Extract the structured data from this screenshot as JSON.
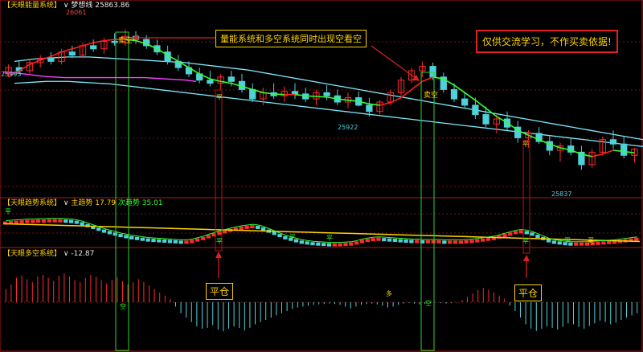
{
  "panels": {
    "energy": {
      "title": "【天眼能量系统】",
      "dropdown": "∨",
      "line_name": "梦想线",
      "value": "25863.86"
    },
    "trend": {
      "title": "【天眼趋势系统】",
      "dropdown": "∨",
      "main_label": "主趋势",
      "main_value": "17.79",
      "sub_label": "次趋势",
      "sub_value": "35.01"
    },
    "longshort": {
      "title": "【天眼多空系统】",
      "dropdown": "∨",
      "value": "-12.87"
    }
  },
  "annotations": {
    "callout": "量能系统和多空系统同时出现空看空",
    "notice": "仅供交流学习，不作买卖依据!",
    "close_position": "平仓",
    "close_position_2": "平仓"
  },
  "price_labels": {
    "high": "26061",
    "left": "25993",
    "mid_low": "25922",
    "low": "25837"
  },
  "markers": {
    "sell": "卖空",
    "sell2": "卖空",
    "flat": "平",
    "buy": "买",
    "empty": "空",
    "many": "多"
  },
  "colors": {
    "background": "#000000",
    "up": "#ff2b2b",
    "down": "#4fd1d9",
    "ma_fast": "#30ff30",
    "ma_red": "#ff2020",
    "band_cyan": "#7fe9ff",
    "band_magenta": "#ff40ff",
    "trend_main": "#ffd400",
    "highlight_box": "#30d030",
    "frame_red": "#b01818",
    "annotation": "#ffd400"
  },
  "chart_data": [
    {
      "type": "candlestick",
      "title": "梦想线 25863.86",
      "ylim": [
        25800,
        26090
      ],
      "candles": [
        [
          25990,
          26005,
          25985,
          26000
        ],
        [
          26000,
          26010,
          25990,
          25995
        ],
        [
          25995,
          26012,
          25990,
          26008
        ],
        [
          26008,
          26020,
          26000,
          26015
        ],
        [
          26015,
          26025,
          26005,
          26010
        ],
        [
          26010,
          26030,
          26005,
          26025
        ],
        [
          26025,
          26035,
          26015,
          26020
        ],
        [
          26020,
          26040,
          26015,
          26035
        ],
        [
          26035,
          26045,
          26025,
          26030
        ],
        [
          26030,
          26048,
          26022,
          26042
        ],
        [
          26042,
          26055,
          26035,
          26040
        ],
        [
          26040,
          26061,
          26035,
          26050
        ],
        [
          26050,
          26058,
          26038,
          26045
        ],
        [
          26045,
          26052,
          26030,
          26035
        ],
        [
          26035,
          26045,
          26020,
          26025
        ],
        [
          26025,
          26035,
          26005,
          26010
        ],
        [
          26010,
          26020,
          25995,
          26000
        ],
        [
          26000,
          26010,
          25985,
          25990
        ],
        [
          25990,
          26000,
          25975,
          25980
        ],
        [
          25980,
          25995,
          25970,
          25975
        ],
        [
          25975,
          25990,
          25965,
          25985
        ],
        [
          25985,
          25995,
          25970,
          25978
        ],
        [
          25978,
          25990,
          25960,
          25965
        ],
        [
          25965,
          25975,
          25945,
          25950
        ],
        [
          25950,
          25968,
          25940,
          25960
        ],
        [
          25960,
          25975,
          25950,
          25955
        ],
        [
          25955,
          25970,
          25945,
          25962
        ],
        [
          25962,
          25975,
          25950,
          25958
        ],
        [
          25958,
          25968,
          25945,
          25950
        ],
        [
          25950,
          25965,
          25940,
          25960
        ],
        [
          25960,
          25972,
          25948,
          25955
        ],
        [
          25955,
          25965,
          25940,
          25945
        ],
        [
          25945,
          25960,
          25935,
          25952
        ],
        [
          25952,
          25962,
          25938,
          25940
        ],
        [
          25940,
          25952,
          25922,
          25930
        ],
        [
          25930,
          25948,
          25925,
          25945
        ],
        [
          25945,
          25965,
          25940,
          25960
        ],
        [
          25960,
          25985,
          25955,
          25980
        ],
        [
          25980,
          26000,
          25975,
          25995
        ],
        [
          25995,
          26010,
          25985,
          26002
        ],
        [
          26002,
          26008,
          25980,
          25985
        ],
        [
          25985,
          25992,
          25960,
          25965
        ],
        [
          25965,
          25975,
          25945,
          25950
        ],
        [
          25950,
          25962,
          25935,
          25940
        ],
        [
          25940,
          25952,
          25918,
          25925
        ],
        [
          25925,
          25938,
          25905,
          25910
        ],
        [
          25910,
          25925,
          25895,
          25918
        ],
        [
          25918,
          25930,
          25900,
          25905
        ],
        [
          25905,
          25915,
          25880,
          25888
        ],
        [
          25888,
          25900,
          25872,
          25895
        ],
        [
          25895,
          25905,
          25878,
          25882
        ],
        [
          25882,
          25892,
          25860,
          25868
        ],
        [
          25868,
          25880,
          25850,
          25875
        ],
        [
          25875,
          25888,
          25860,
          25865
        ],
        [
          25865,
          25875,
          25837,
          25845
        ],
        [
          25845,
          25870,
          25840,
          25865
        ],
        [
          25865,
          25890,
          25860,
          25885
        ],
        [
          25885,
          25900,
          25870,
          25878
        ],
        [
          25878,
          25890,
          25855,
          25860
        ],
        [
          25860,
          25872,
          25848,
          25870
        ]
      ],
      "series": [
        {
          "name": "fast_ma",
          "values": [
            25985,
            25995,
            26005,
            26012,
            26018,
            26025,
            26030,
            26035,
            26040,
            26043,
            26045,
            26045,
            26043,
            26038,
            26030,
            26020,
            26010,
            26000,
            25990,
            25982,
            25978,
            25975,
            25970,
            25965,
            25960,
            25958,
            25957,
            25957,
            25955,
            25954,
            25953,
            25950,
            25948,
            25946,
            25942,
            25940,
            25944,
            25952,
            25965,
            25978,
            25985,
            25982,
            25972,
            25960,
            25948,
            25935,
            25922,
            25912,
            25900,
            25892,
            25885,
            25878,
            25872,
            25868,
            25862,
            25858,
            25862,
            25868,
            25866,
            25864
          ]
        },
        {
          "name": "band_upper",
          "values": [
            26010,
            26012,
            26014,
            26015,
            26016,
            26017,
            26017,
            26017,
            26016,
            26015,
            26014,
            26013,
            26012,
            26011,
            26010,
            26009,
            26008,
            26006,
            26004,
            26002,
            26000,
            25998,
            25996,
            25993,
            25990,
            25987,
            25984,
            25981,
            25978,
            25975,
            25972,
            25969,
            25966,
            25963,
            25960,
            25957,
            25954,
            25951,
            25948,
            25945,
            25942,
            25939,
            25936,
            25933,
            25930,
            25927,
            25924,
            25921,
            25918,
            25915,
            25912,
            25909,
            25906,
            25903,
            25900,
            25897,
            25894,
            25891,
            25888,
            25885
          ]
        },
        {
          "name": "band_lower",
          "values": [
            25975,
            25976,
            25977,
            25978,
            25978,
            25978,
            25977,
            25976,
            25975,
            25974,
            25972,
            25970,
            25968,
            25966,
            25964,
            25962,
            25960,
            25958,
            25956,
            25954,
            25952,
            25950,
            25948,
            25946,
            25944,
            25942,
            25940,
            25938,
            25936,
            25934,
            25932,
            25930,
            25928,
            25926,
            25924,
            25922,
            25920,
            25918,
            25916,
            25914,
            25912,
            25910,
            25908,
            25906,
            25904,
            25902,
            25900,
            25898,
            25896,
            25894,
            25892,
            25890,
            25888,
            25886,
            25884,
            25882,
            25880,
            25878,
            25876,
            25874
          ]
        },
        {
          "name": "magenta_band",
          "values": [
            25993,
            25992,
            25990,
            25988,
            25986,
            25985,
            25984,
            25984,
            25984,
            25984,
            25984,
            25984,
            25984,
            25984,
            25984,
            25983,
            25982,
            25981,
            25980,
            25978
          ]
        }
      ]
    },
    {
      "type": "bar",
      "title": "主趋势 17.79 次趋势 35.01",
      "ylim": [
        0,
        100
      ],
      "values": [
        62,
        63,
        64,
        65,
        66,
        66,
        67,
        67,
        68,
        68,
        68,
        67,
        66,
        64,
        60,
        55,
        50,
        45,
        40,
        36,
        32,
        28,
        25,
        22,
        20,
        18,
        16,
        15,
        14,
        13,
        12,
        11,
        10,
        10,
        12,
        16,
        20,
        25,
        30,
        34,
        38,
        42,
        45,
        48,
        50,
        52,
        50,
        46,
        40,
        34,
        28,
        22,
        18,
        14,
        10,
        8,
        6,
        5,
        4,
        3,
        3,
        3,
        4,
        5,
        8,
        12,
        15,
        17,
        18,
        17,
        16,
        15,
        14,
        13,
        12,
        12,
        11,
        11,
        11,
        11,
        10,
        10,
        10,
        10,
        11,
        12,
        14,
        16,
        18,
        20,
        24,
        28,
        32,
        36,
        38,
        36,
        32,
        26,
        20,
        14,
        10,
        8,
        6,
        5,
        5,
        5,
        5,
        6,
        7,
        8,
        9,
        10,
        12,
        14,
        16,
        18
      ]
    },
    {
      "type": "bar",
      "title": "-12.87",
      "ylim": [
        -100,
        100
      ],
      "values": [
        30,
        40,
        55,
        60,
        52,
        45,
        58,
        62,
        55,
        48,
        60,
        65,
        58,
        50,
        45,
        55,
        62,
        58,
        50,
        42,
        50,
        56,
        48,
        40,
        45,
        52,
        46,
        38,
        30,
        22,
        15,
        8,
        -10,
        -25,
        -35,
        -45,
        -55,
        -60,
        -58,
        -52,
        -62,
        -66,
        -60,
        -55,
        -58,
        -64,
        -58,
        -50,
        -45,
        -40,
        -35,
        -30,
        -25,
        -20,
        -15,
        -12,
        -10,
        -8,
        -6,
        -5,
        -4,
        -3,
        -4,
        -6,
        -10,
        -14,
        -10,
        -6,
        -4,
        -3,
        -5,
        -8,
        -12,
        -10,
        -6,
        -3,
        -2,
        -3,
        -5,
        -4,
        -2,
        -1,
        -2,
        -3,
        -2,
        -1,
        5,
        12,
        20,
        28,
        32,
        28,
        22,
        15,
        8,
        -8,
        -20,
        -35,
        -50,
        -60,
        -65,
        -60,
        -55,
        -58,
        -62,
        -56,
        -48,
        -50,
        -56,
        -60,
        -54,
        -48,
        -42,
        -45,
        -50,
        -46,
        -40,
        -35,
        -30,
        -25
      ]
    }
  ]
}
